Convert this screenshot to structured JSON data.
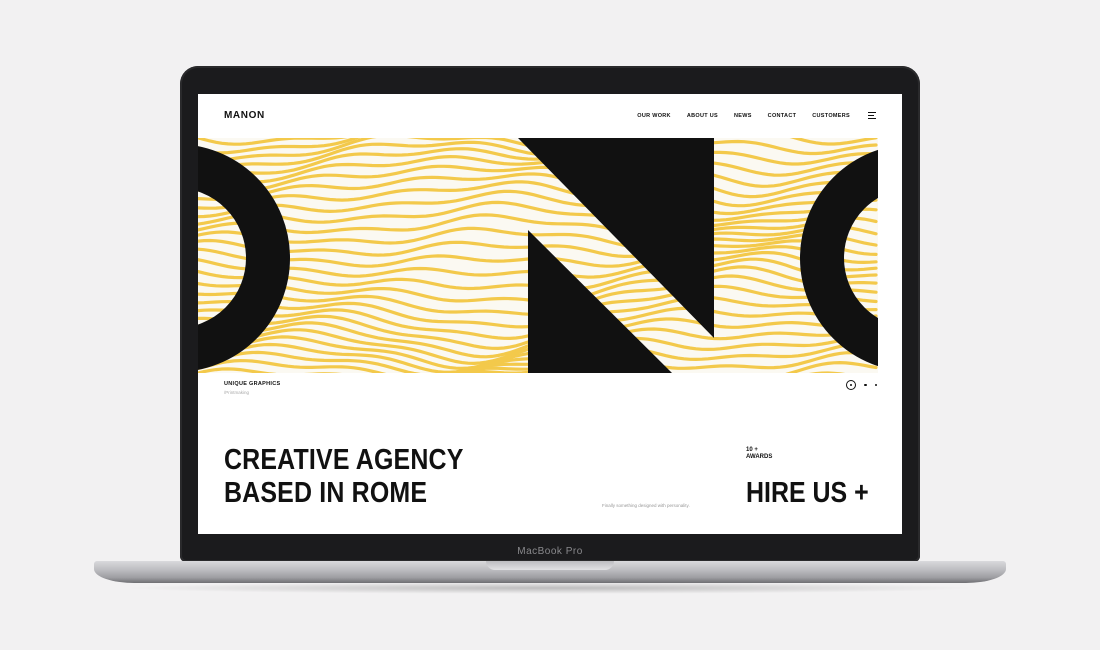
{
  "device": {
    "label": "MacBook Pro"
  },
  "site": {
    "logo": "MANON",
    "nav": [
      "OUR WORK",
      "ABOUT US",
      "NEWS",
      "CONTACT",
      "CUSTOMERS"
    ],
    "hero": {
      "caption_title": "UNIQUE GRAPHICS",
      "caption_sub": "/Printmaking",
      "slide_count": 3,
      "active_slide": 1
    },
    "headline": [
      "CREATIVE AGENCY",
      "BASED IN ROME"
    ],
    "tagline": "Finally something designed with personality.",
    "awards": [
      "10 +",
      "AWARDS"
    ],
    "cta": "HIRE US +"
  },
  "colors": {
    "accent": "#f3c94b",
    "ink": "#111111",
    "paper": "#fbf9f2"
  },
  "icons": {
    "menu": "menu-icon"
  }
}
